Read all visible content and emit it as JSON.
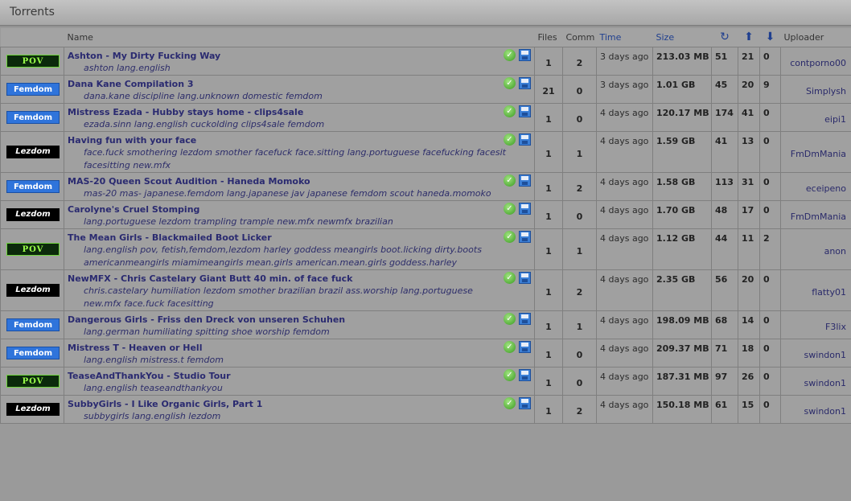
{
  "panel": {
    "title": "Torrents"
  },
  "columns": {
    "name": "Name",
    "files": "Files",
    "comm": "Comm",
    "time": "Time",
    "size": "Size",
    "uploader": "Uploader",
    "refresh_icon": "refresh-icon",
    "seeders_icon": "arrow-up-icon",
    "leechers_icon": "arrow-down-icon"
  },
  "colors": {
    "pov": "#9bff4a",
    "femdom": "#2f74db",
    "lezdom": "#000000",
    "accent": "#1f3f8f"
  },
  "rows": [
    {
      "category": "POV",
      "cat_class": "pov",
      "name": "Ashton - My Dirty Fucking Way",
      "tags": "ashton lang.english",
      "files": "1",
      "comm": "2",
      "time": "3 days ago",
      "size": "213.03 MB",
      "r": "51",
      "up": "21",
      "down": "0",
      "uploader": "contporno00"
    },
    {
      "category": "Femdom",
      "cat_class": "femdom",
      "name": "Dana Kane Compilation 3",
      "tags": "dana.kane discipline lang.unknown domestic femdom",
      "files": "21",
      "comm": "0",
      "time": "3 days ago",
      "size": "1.01 GB",
      "r": "45",
      "up": "20",
      "down": "9",
      "uploader": "Simplysh"
    },
    {
      "category": "Femdom",
      "cat_class": "femdom",
      "name": "Mistress Ezada - Hubby stays home - clips4sale",
      "tags": "ezada.sinn lang.english cuckolding clips4sale femdom",
      "files": "1",
      "comm": "0",
      "time": "4 days ago",
      "size": "120.17 MB",
      "r": "174",
      "up": "41",
      "down": "0",
      "uploader": "eipi1"
    },
    {
      "category": "Lezdom",
      "cat_class": "lezdom",
      "name": "Having fun with your face",
      "tags": "face.fuck smothering lezdom smother facefuck face.sitting lang.portuguese facefucking facesit facesitting new.mfx",
      "files": "1",
      "comm": "1",
      "time": "4 days ago",
      "size": "1.59 GB",
      "r": "41",
      "up": "13",
      "down": "0",
      "uploader": "FmDmMania"
    },
    {
      "category": "Femdom",
      "cat_class": "femdom",
      "name": "MAS-20 Queen Scout Audition - Haneda Momoko",
      "tags": "mas-20 mas- japanese.femdom lang.japanese jav japanese femdom scout haneda.momoko",
      "files": "1",
      "comm": "2",
      "time": "4 days ago",
      "size": "1.58 GB",
      "r": "113",
      "up": "31",
      "down": "0",
      "uploader": "eceipeno"
    },
    {
      "category": "Lezdom",
      "cat_class": "lezdom",
      "name": "Carolyne's Cruel Stomping",
      "tags": "lang.portuguese lezdom trampling trample new.mfx newmfx brazilian",
      "files": "1",
      "comm": "0",
      "time": "4 days ago",
      "size": "1.70 GB",
      "r": "48",
      "up": "17",
      "down": "0",
      "uploader": "FmDmMania"
    },
    {
      "category": "POV",
      "cat_class": "pov",
      "name": "The Mean Girls - Blackmailed Boot Licker",
      "tags": "lang.english pov, fetish,femdom,lezdom harley goddess meangirls boot.licking dirty.boots americanmeangirls miamimeangirls mean.girls american.mean.girls goddess.harley",
      "files": "1",
      "comm": "1",
      "time": "4 days ago",
      "size": "1.12 GB",
      "r": "44",
      "up": "11",
      "down": "2",
      "uploader": "anon"
    },
    {
      "category": "Lezdom",
      "cat_class": "lezdom",
      "name": "NewMFX - Chris Castelary Giant Butt 40 min. of face fuck",
      "tags": "chris.castelary humiliation lezdom smother brazilian brazil ass.worship lang.portuguese new.mfx face.fuck facesitting",
      "files": "1",
      "comm": "2",
      "time": "4 days ago",
      "size": "2.35 GB",
      "r": "56",
      "up": "20",
      "down": "0",
      "uploader": "flatty01"
    },
    {
      "category": "Femdom",
      "cat_class": "femdom",
      "name": "Dangerous Girls - Friss den Dreck von unseren Schuhen",
      "tags": "lang.german humiliating spitting shoe worship femdom",
      "files": "1",
      "comm": "1",
      "time": "4 days ago",
      "size": "198.09 MB",
      "r": "68",
      "up": "14",
      "down": "0",
      "uploader": "F3lix"
    },
    {
      "category": "Femdom",
      "cat_class": "femdom",
      "name": "Mistress T - Heaven or Hell",
      "tags": "lang.english mistress.t femdom",
      "files": "1",
      "comm": "0",
      "time": "4 days ago",
      "size": "209.37 MB",
      "r": "71",
      "up": "18",
      "down": "0",
      "uploader": "swindon1"
    },
    {
      "category": "POV",
      "cat_class": "pov",
      "name": "TeaseAndThankYou - Studio Tour",
      "tags": "lang.english teaseandthankyou",
      "files": "1",
      "comm": "0",
      "time": "4 days ago",
      "size": "187.31 MB",
      "r": "97",
      "up": "26",
      "down": "0",
      "uploader": "swindon1"
    },
    {
      "category": "Lezdom",
      "cat_class": "lezdom",
      "name": "SubbyGirls - I Like Organic Girls, Part 1",
      "tags": "subbygirls lang.english lezdom",
      "files": "1",
      "comm": "2",
      "time": "4 days ago",
      "size": "150.18 MB",
      "r": "61",
      "up": "15",
      "down": "0",
      "uploader": "swindon1"
    }
  ]
}
